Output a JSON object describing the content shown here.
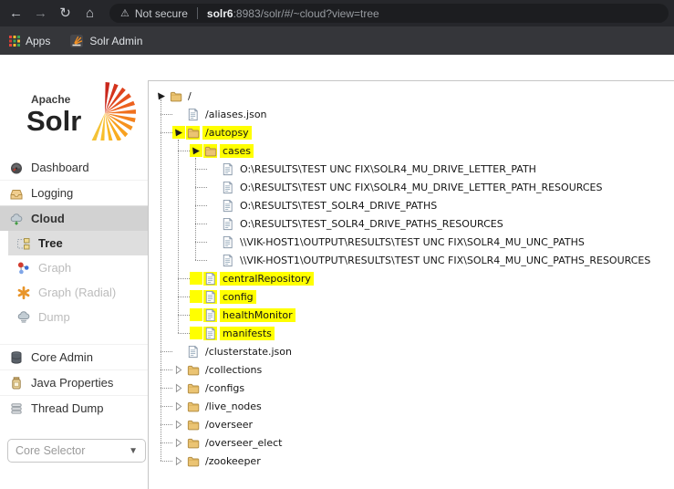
{
  "browser": {
    "nav_icons": [
      "back-icon",
      "forward-icon",
      "reload-icon",
      "home-icon"
    ],
    "address_bar": {
      "warning_icon": "warning-triangle-icon",
      "warning_label": "Not secure",
      "url_host": "solr6",
      "url_rest": ":8983/solr/#/~cloud?view=tree"
    },
    "bookmarks": [
      {
        "label": "Apps",
        "icon": "apps-grid-icon"
      },
      {
        "label": "Solr Admin",
        "icon": "solr-favicon"
      }
    ]
  },
  "sidebar": {
    "logo": {
      "line1": "Apache",
      "line2": "Solr",
      "icon": "solr-sunburst-logo"
    },
    "nav_top": [
      {
        "label": "Dashboard",
        "icon": "dashboard-gauge-icon",
        "active": false
      },
      {
        "label": "Logging",
        "icon": "logging-inbox-icon",
        "active": false
      },
      {
        "label": "Cloud",
        "icon": "cloud-icon",
        "active": true
      }
    ],
    "cloud_sub": [
      {
        "label": "Tree",
        "icon": "tree-icon",
        "active": true
      },
      {
        "label": "Graph",
        "icon": "graph-molecule-icon",
        "active": false
      },
      {
        "label": "Graph (Radial)",
        "icon": "radial-graph-icon",
        "active": false
      },
      {
        "label": "Dump",
        "icon": "dump-cloud-icon",
        "active": false
      }
    ],
    "nav_bottom": [
      {
        "label": "Core Admin",
        "icon": "core-admin-icon"
      },
      {
        "label": "Java Properties",
        "icon": "java-properties-icon"
      },
      {
        "label": "Thread Dump",
        "icon": "thread-dump-icon"
      }
    ],
    "core_selector": {
      "placeholder": "Core Selector",
      "icon": "chevron-down-icon"
    }
  },
  "tree": {
    "highlight_color": "#ffff00",
    "nodes": [
      {
        "label": "/",
        "type": "folder",
        "state": "expanded",
        "level": 0,
        "highlighted": false
      },
      {
        "label": "/aliases.json",
        "type": "file",
        "level": 1,
        "highlighted": false
      },
      {
        "label": "/autopsy",
        "type": "folder",
        "state": "expanded",
        "level": 1,
        "highlighted": true
      },
      {
        "label": "cases",
        "type": "folder",
        "state": "expanded",
        "level": 2,
        "highlighted": true
      },
      {
        "label": "O:\\RESULTS\\TEST UNC FIX\\SOLR4_MU_DRIVE_LETTER_PATH",
        "type": "file",
        "level": 3,
        "highlighted": false
      },
      {
        "label": "O:\\RESULTS\\TEST UNC FIX\\SOLR4_MU_DRIVE_LETTER_PATH_RESOURCES",
        "type": "file",
        "level": 3,
        "highlighted": false
      },
      {
        "label": "O:\\RESULTS\\TEST_SOLR4_DRIVE_PATHS",
        "type": "file",
        "level": 3,
        "highlighted": false
      },
      {
        "label": "O:\\RESULTS\\TEST_SOLR4_DRIVE_PATHS_RESOURCES",
        "type": "file",
        "level": 3,
        "highlighted": false
      },
      {
        "label": "\\\\VIK-HOST1\\OUTPUT\\RESULTS\\TEST UNC FIX\\SOLR4_MU_UNC_PATHS",
        "type": "file",
        "level": 3,
        "highlighted": false
      },
      {
        "label": "\\\\VIK-HOST1\\OUTPUT\\RESULTS\\TEST UNC FIX\\SOLR4_MU_UNC_PATHS_RESOURCES",
        "type": "file",
        "level": 3,
        "highlighted": false
      },
      {
        "label": "centralRepository",
        "type": "file",
        "level": 2,
        "highlighted": true
      },
      {
        "label": "config",
        "type": "file",
        "level": 2,
        "highlighted": true
      },
      {
        "label": "healthMonitor",
        "type": "file",
        "level": 2,
        "highlighted": true
      },
      {
        "label": "manifests",
        "type": "file",
        "level": 2,
        "highlighted": true
      },
      {
        "label": "/clusterstate.json",
        "type": "file",
        "level": 1,
        "highlighted": false
      },
      {
        "label": "/collections",
        "type": "folder",
        "state": "collapsed",
        "level": 1,
        "highlighted": false
      },
      {
        "label": "/configs",
        "type": "folder",
        "state": "collapsed",
        "level": 1,
        "highlighted": false
      },
      {
        "label": "/live_nodes",
        "type": "folder",
        "state": "collapsed",
        "level": 1,
        "highlighted": false
      },
      {
        "label": "/overseer",
        "type": "folder",
        "state": "collapsed",
        "level": 1,
        "highlighted": false
      },
      {
        "label": "/overseer_elect",
        "type": "folder",
        "state": "collapsed",
        "level": 1,
        "highlighted": false
      },
      {
        "label": "/zookeeper",
        "type": "folder",
        "state": "collapsed",
        "level": 1,
        "highlighted": false
      }
    ]
  },
  "colors": {
    "highlight": "#ffff00",
    "chrome_toolbar": "#26272b",
    "chrome_bookmarks": "#35363a",
    "omnibox": "#1c1d20",
    "active_menu_bg": "#d2d2d2",
    "panel_border": "#c6c6c6",
    "logo_orange": "#ef701d"
  }
}
